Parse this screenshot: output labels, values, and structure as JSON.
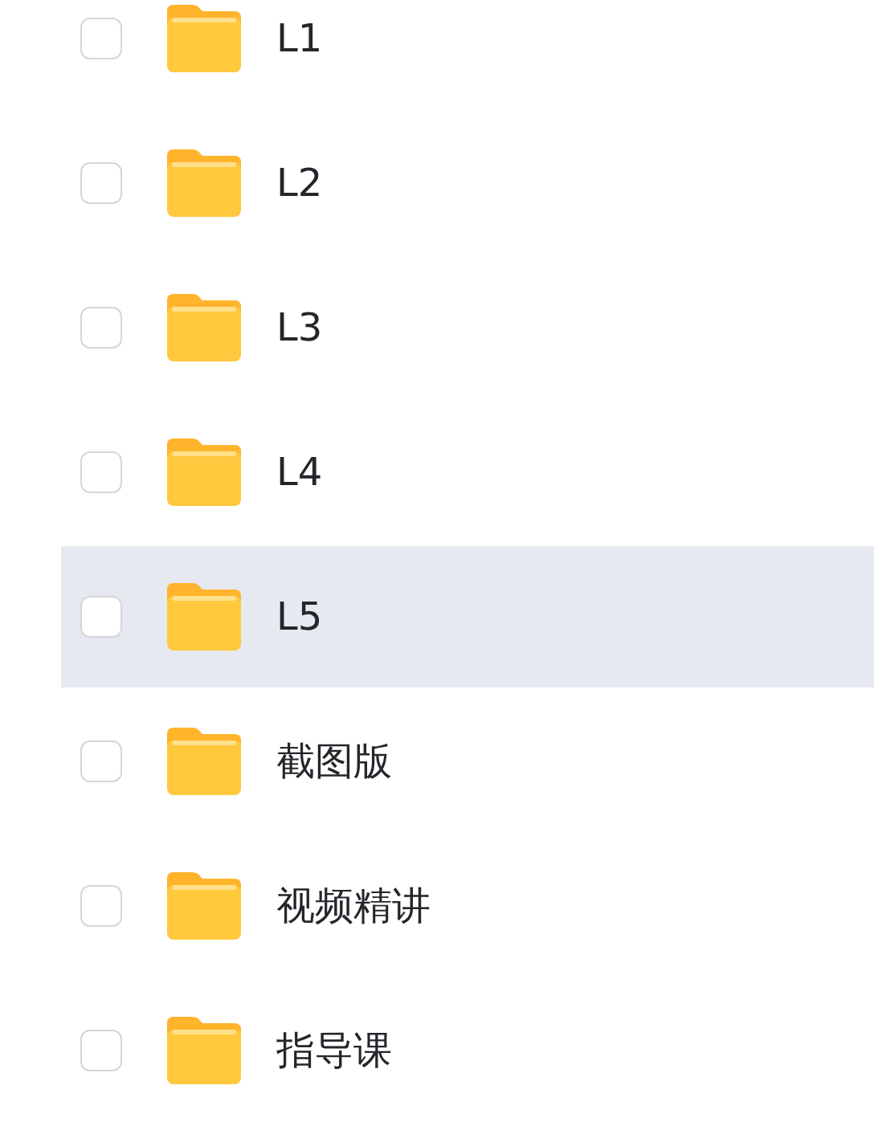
{
  "folders": [
    {
      "name": "L1",
      "checked": false,
      "hovered": false
    },
    {
      "name": "L2",
      "checked": false,
      "hovered": false
    },
    {
      "name": "L3",
      "checked": false,
      "hovered": false
    },
    {
      "name": "L4",
      "checked": false,
      "hovered": false
    },
    {
      "name": "L5",
      "checked": false,
      "hovered": true
    },
    {
      "name": "截图版",
      "checked": false,
      "hovered": false
    },
    {
      "name": "视频精讲",
      "checked": false,
      "hovered": false
    },
    {
      "name": "指导课",
      "checked": false,
      "hovered": false
    }
  ]
}
